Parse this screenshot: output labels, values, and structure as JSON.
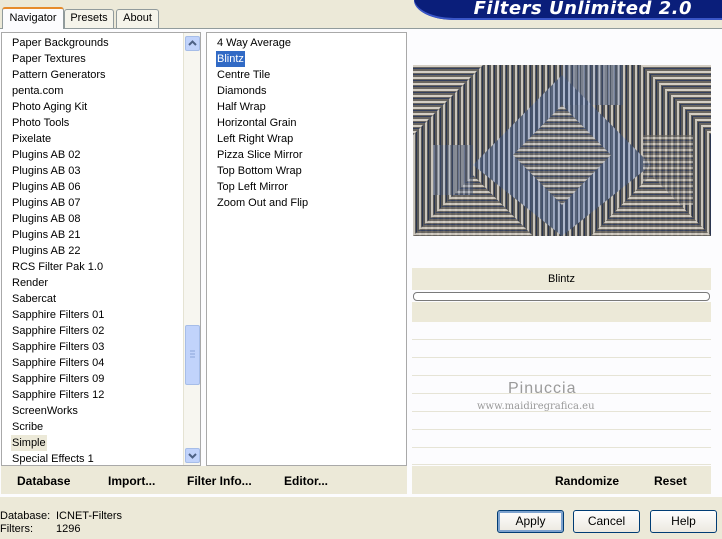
{
  "app": {
    "title": "Filters Unlimited 2.0"
  },
  "tabs": [
    {
      "label": "Navigator",
      "active": true
    },
    {
      "label": "Presets",
      "active": false
    },
    {
      "label": "About",
      "active": false
    }
  ],
  "categories": {
    "items": [
      "Paper Backgrounds",
      "Paper Textures",
      "Pattern Generators",
      "penta.com",
      "Photo Aging Kit",
      "Photo Tools",
      "Pixelate",
      "Plugins AB 02",
      "Plugins AB 03",
      "Plugins AB 06",
      "Plugins AB 07",
      "Plugins AB 08",
      "Plugins AB 21",
      "Plugins AB 22",
      "RCS Filter Pak 1.0",
      "Render",
      "Sabercat",
      "Sapphire Filters 01",
      "Sapphire Filters 02",
      "Sapphire Filters 03",
      "Sapphire Filters 04",
      "Sapphire Filters 09",
      "Sapphire Filters 12",
      "ScreenWorks",
      "Scribe",
      "Simple",
      "Special Effects 1"
    ],
    "selected": "Simple"
  },
  "filters": {
    "items": [
      "4 Way Average",
      "Blintz",
      "Centre Tile",
      "Diamonds",
      "Half Wrap",
      "Horizontal Grain",
      "Left Right Wrap",
      "Pizza Slice Mirror",
      "Top Bottom Wrap",
      "Top Left Mirror",
      "Zoom Out and Flip"
    ],
    "selected": "Blintz"
  },
  "preview": {
    "filter_name": "Blintz"
  },
  "watermark": {
    "name": "Pinuccia",
    "url": "www.maidiregrafica.eu"
  },
  "links": {
    "database": "Database",
    "import": "Import...",
    "filter_info": "Filter Info...",
    "editor": "Editor...",
    "randomize": "Randomize",
    "reset": "Reset"
  },
  "status": {
    "database_label": "Database:",
    "database_value": "ICNET-Filters",
    "filters_label": "Filters:",
    "filters_value": "1296"
  },
  "buttons": {
    "apply": "Apply",
    "cancel": "Cancel",
    "help": "Help"
  },
  "colors": {
    "selection": "#316ac5",
    "title_banner": "#0a1e7a",
    "tab_accent": "#e68b2c"
  },
  "icons": {
    "scroll_up": "chevron-up-icon",
    "scroll_down": "chevron-down-icon"
  }
}
